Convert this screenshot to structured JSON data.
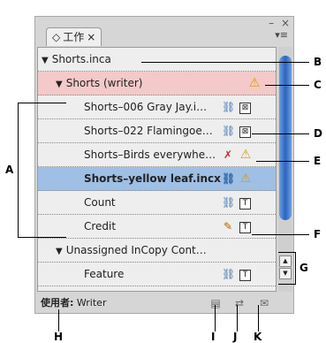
{
  "window": {
    "tab_label": "工作",
    "tab_icon": "diamond-icon",
    "close": "×",
    "minimize": "–",
    "menu": "▾≡"
  },
  "rows": [
    {
      "name": "Shorts.inca",
      "kind": "file"
    },
    {
      "name": "Shorts (writer)",
      "kind": "assignment"
    },
    {
      "name": "Shorts–006 Gray Jay.i…"
    },
    {
      "name": "Shorts–022 Flamingoe…"
    },
    {
      "name": "Shorts–Birds everywhe…"
    },
    {
      "name": "Shorts–yellow leaf.incx",
      "selected": true
    },
    {
      "name": "Count"
    },
    {
      "name": "Credit"
    },
    {
      "name": "Unassigned InCopy Cont…",
      "kind": "group"
    },
    {
      "name": "Feature"
    }
  ],
  "footer": {
    "user_label": "使用者:",
    "user": "Writer"
  },
  "callouts": [
    "A",
    "B",
    "C",
    "D",
    "E",
    "F",
    "G",
    "H",
    "I",
    "J",
    "K"
  ],
  "colors": {
    "selection": "#9fbfe5",
    "assignment": "#f3c9c9",
    "scroll_thumb": "#2c63bf"
  }
}
